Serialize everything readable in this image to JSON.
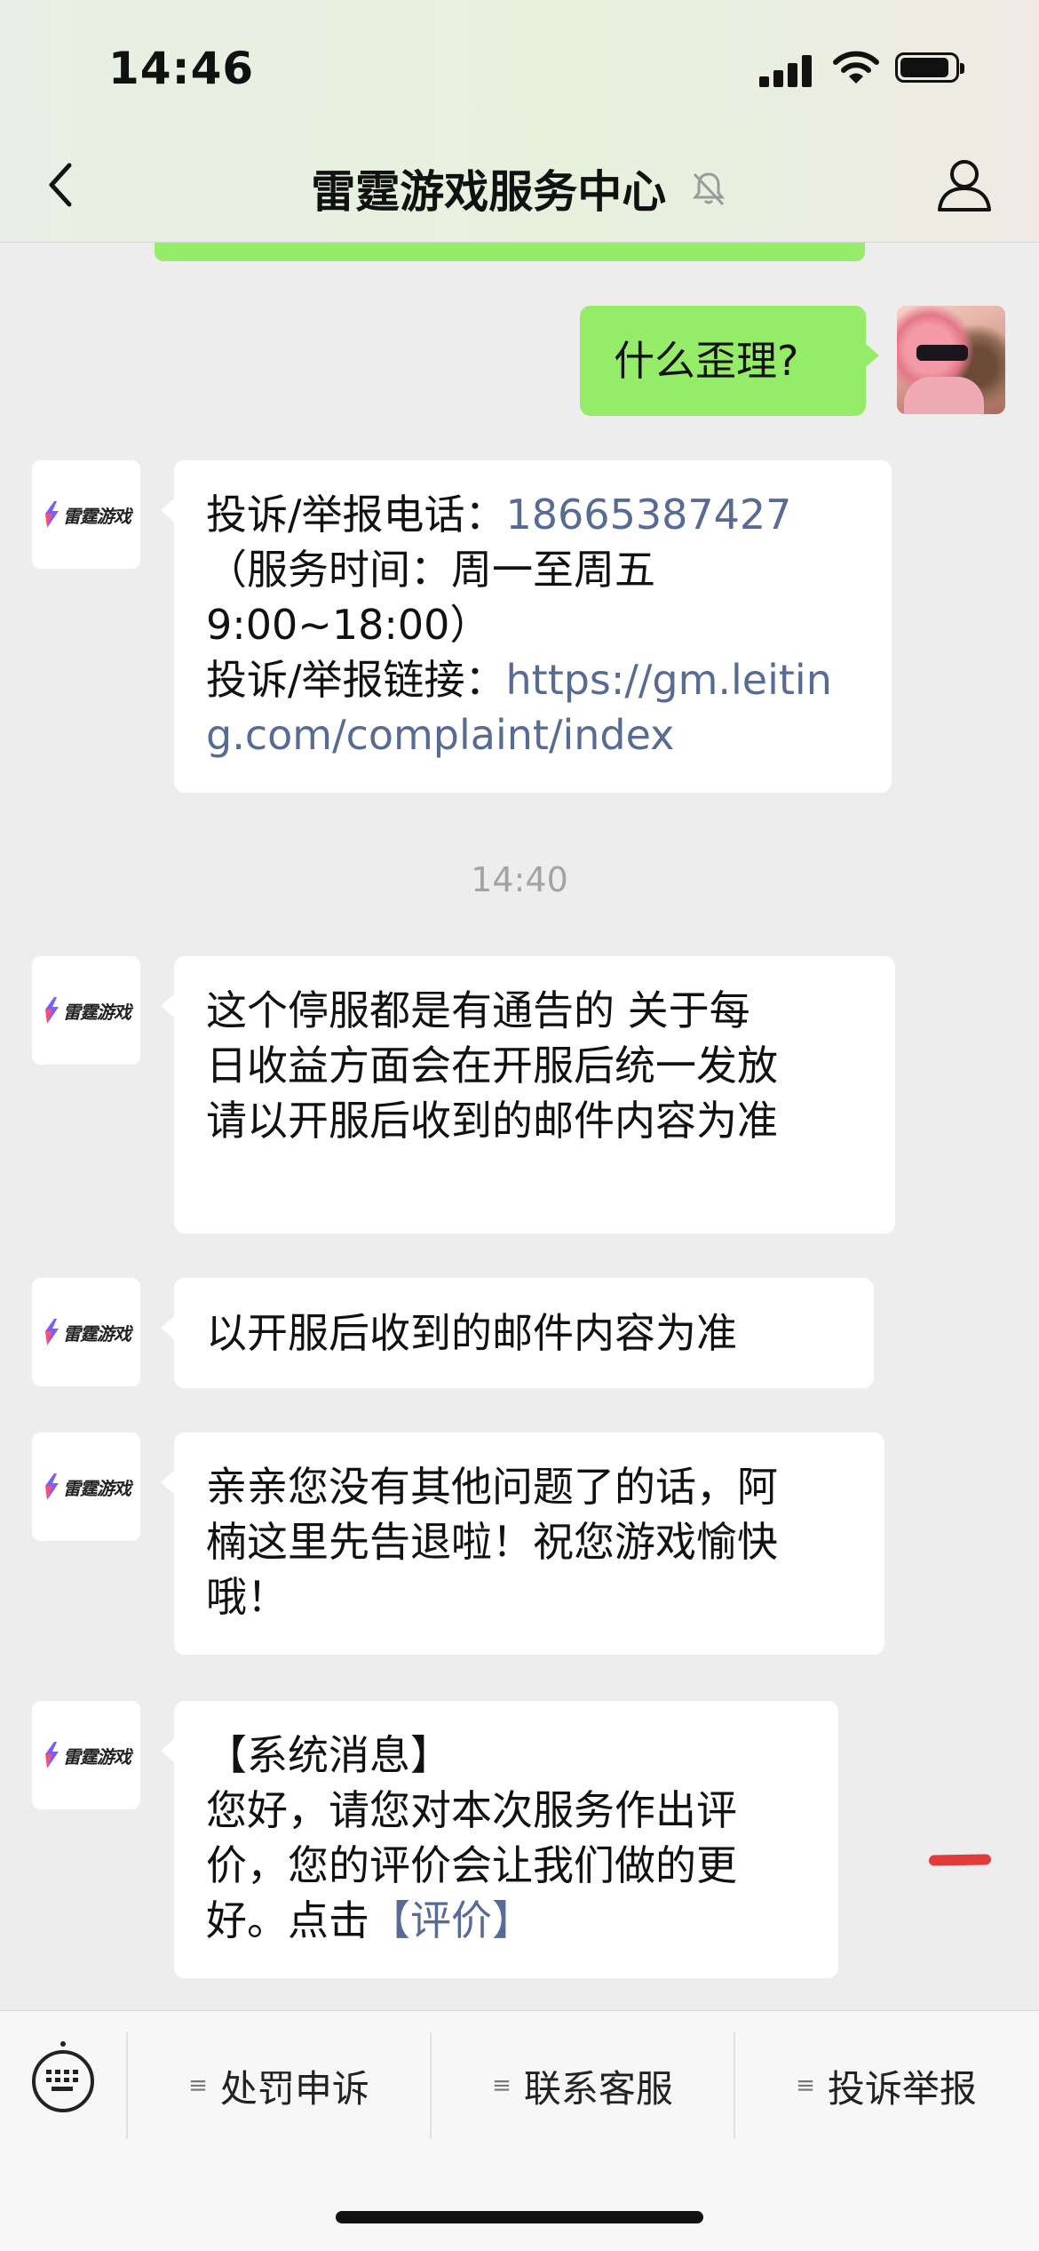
{
  "status_bar": {
    "time": "14:46"
  },
  "header": {
    "title": "雷霆游戏服务中心"
  },
  "messages": {
    "out": {
      "text": "什么歪理?"
    },
    "m1": {
      "line1_label": "投诉/举报电话：",
      "phone": "18665387427",
      "line2": "（服务时间：周一至周五",
      "line3": "9:00~18:00）",
      "line4_label": "投诉/举报链接：",
      "url_part1": "https://gm.leitin",
      "url_part2": "g.com/complaint/index"
    },
    "timestamp": "14:40",
    "m2": {
      "lines": [
        "这个停服都是有通告的  关于每",
        "日收益方面会在开服后统一发放",
        "请以开服后收到的邮件内容为准"
      ]
    },
    "m3": {
      "text": "以开服后收到的邮件内容为准"
    },
    "m4": {
      "lines": [
        "亲亲您没有其他问题了的话，阿",
        "楠这里先告退啦！祝您游戏愉快",
        "哦！"
      ]
    },
    "m5": {
      "line1": "【系统消息】",
      "line2": "您好，请您对本次服务作出评",
      "line3": "价，您的评价会让我们做的更",
      "line4_prefix": "好。点击",
      "rate_link": "【评价】"
    }
  },
  "logo_text": "雷霆游戏",
  "bottom_menu": {
    "items": [
      "处罚申诉",
      "联系客服",
      "投诉举报"
    ]
  },
  "colors": {
    "out_bubble": "#95ec69",
    "link": "#576b95",
    "background": "#ededed"
  }
}
